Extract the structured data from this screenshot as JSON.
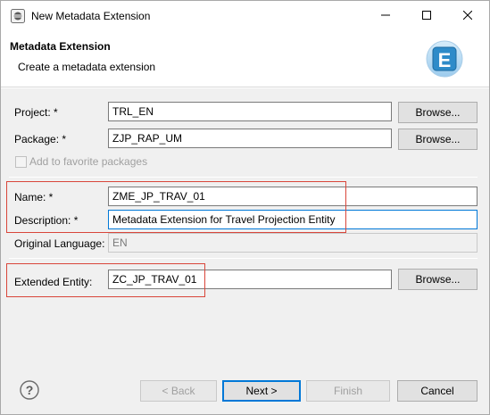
{
  "window": {
    "title": "New Metadata Extension",
    "controls": {
      "minimize": "minimize-icon",
      "maximize": "maximize-icon",
      "close": "close-icon"
    }
  },
  "banner": {
    "title": "Metadata Extension",
    "subtitle": "Create a metadata extension",
    "logo_letter": "E",
    "logo_color": "#2e8bc9"
  },
  "form": {
    "project": {
      "label": "Project: *",
      "value": "TRL_EN",
      "browse": "Browse..."
    },
    "package": {
      "label": "Package: *",
      "value": "ZJP_RAP_UM",
      "browse": "Browse..."
    },
    "favorite": {
      "label": "Add to favorite packages",
      "checked": false
    },
    "name": {
      "label": "Name: *",
      "value": "ZME_JP_TRAV_01"
    },
    "description": {
      "label": "Description: *",
      "value": "Metadata Extension for Travel Projection Entity"
    },
    "original_language": {
      "label": "Original Language:",
      "value": "EN"
    },
    "extended_entity": {
      "label": "Extended Entity:",
      "value": "ZC_JP_TRAV_01",
      "browse": "Browse..."
    }
  },
  "footer": {
    "help_icon": "help-icon",
    "back": "< Back",
    "next": "Next >",
    "finish": "Finish",
    "cancel": "Cancel"
  },
  "colors": {
    "highlight": "#d9463a",
    "focus": "#0078d7"
  }
}
